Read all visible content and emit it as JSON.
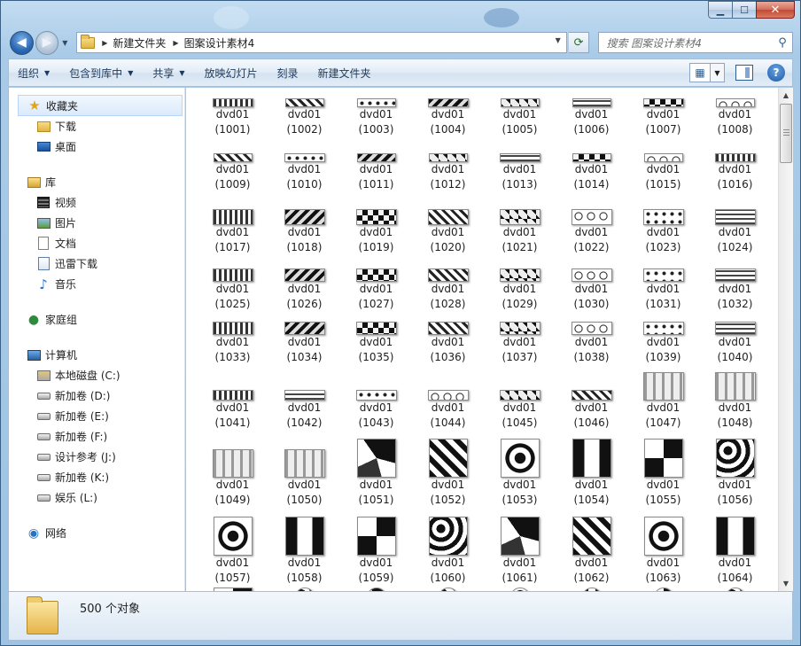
{
  "window": {
    "caption": {
      "minimize": "▁",
      "maximize": "☐",
      "close": "✕"
    }
  },
  "nav": {
    "back_icon": "◀",
    "forward_icon": "▶",
    "breadcrumb": [
      "新建文件夹",
      "图案设计素材4"
    ],
    "refresh_icon": "⟳",
    "search_placeholder": "搜索 图案设计素材4",
    "search_icon": "⚲"
  },
  "toolbar": {
    "organize": "组织",
    "include_in_library": "包含到库中",
    "share": "共享",
    "slideshow": "放映幻灯片",
    "burn": "刻录",
    "new_folder": "新建文件夹",
    "help": "?"
  },
  "sidebar": {
    "favorites": {
      "label": "收藏夹",
      "items": [
        "下载",
        "桌面"
      ]
    },
    "libraries": {
      "label": "库",
      "items": [
        "视频",
        "图片",
        "文档",
        "迅雷下载",
        "音乐"
      ]
    },
    "homegroup": {
      "label": "家庭组"
    },
    "computer": {
      "label": "计算机",
      "items": [
        "本地磁盘 (C:)",
        "新加卷 (D:)",
        "新加卷 (E:)",
        "新加卷 (F:)",
        "设计参考 (J:)",
        "新加卷 (K:)",
        "娱乐 (L:)"
      ]
    },
    "network": {
      "label": "网络"
    }
  },
  "files": [
    {
      "name": "dvd01",
      "num": "(1001)"
    },
    {
      "name": "dvd01",
      "num": "(1002)"
    },
    {
      "name": "dvd01",
      "num": "(1003)"
    },
    {
      "name": "dvd01",
      "num": "(1004)"
    },
    {
      "name": "dvd01",
      "num": "(1005)"
    },
    {
      "name": "dvd01",
      "num": "(1006)"
    },
    {
      "name": "dvd01",
      "num": "(1007)"
    },
    {
      "name": "dvd01",
      "num": "(1008)"
    },
    {
      "name": "dvd01",
      "num": "(1009)"
    },
    {
      "name": "dvd01",
      "num": "(1010)"
    },
    {
      "name": "dvd01",
      "num": "(1011)"
    },
    {
      "name": "dvd01",
      "num": "(1012)"
    },
    {
      "name": "dvd01",
      "num": "(1013)"
    },
    {
      "name": "dvd01",
      "num": "(1014)"
    },
    {
      "name": "dvd01",
      "num": "(1015)"
    },
    {
      "name": "dvd01",
      "num": "(1016)"
    },
    {
      "name": "dvd01",
      "num": "(1017)"
    },
    {
      "name": "dvd01",
      "num": "(1018)"
    },
    {
      "name": "dvd01",
      "num": "(1019)"
    },
    {
      "name": "dvd01",
      "num": "(1020)"
    },
    {
      "name": "dvd01",
      "num": "(1021)"
    },
    {
      "name": "dvd01",
      "num": "(1022)"
    },
    {
      "name": "dvd01",
      "num": "(1023)"
    },
    {
      "name": "dvd01",
      "num": "(1024)"
    },
    {
      "name": "dvd01",
      "num": "(1025)"
    },
    {
      "name": "dvd01",
      "num": "(1026)"
    },
    {
      "name": "dvd01",
      "num": "(1027)"
    },
    {
      "name": "dvd01",
      "num": "(1028)"
    },
    {
      "name": "dvd01",
      "num": "(1029)"
    },
    {
      "name": "dvd01",
      "num": "(1030)"
    },
    {
      "name": "dvd01",
      "num": "(1031)"
    },
    {
      "name": "dvd01",
      "num": "(1032)"
    },
    {
      "name": "dvd01",
      "num": "(1033)"
    },
    {
      "name": "dvd01",
      "num": "(1034)"
    },
    {
      "name": "dvd01",
      "num": "(1035)"
    },
    {
      "name": "dvd01",
      "num": "(1036)"
    },
    {
      "name": "dvd01",
      "num": "(1037)"
    },
    {
      "name": "dvd01",
      "num": "(1038)"
    },
    {
      "name": "dvd01",
      "num": "(1039)"
    },
    {
      "name": "dvd01",
      "num": "(1040)"
    },
    {
      "name": "dvd01",
      "num": "(1041)"
    },
    {
      "name": "dvd01",
      "num": "(1042)"
    },
    {
      "name": "dvd01",
      "num": "(1043)"
    },
    {
      "name": "dvd01",
      "num": "(1044)"
    },
    {
      "name": "dvd01",
      "num": "(1045)"
    },
    {
      "name": "dvd01",
      "num": "(1046)"
    },
    {
      "name": "dvd01",
      "num": "(1047)"
    },
    {
      "name": "dvd01",
      "num": "(1048)"
    },
    {
      "name": "dvd01",
      "num": "(1049)"
    },
    {
      "name": "dvd01",
      "num": "(1050)"
    },
    {
      "name": "dvd01",
      "num": "(1051)"
    },
    {
      "name": "dvd01",
      "num": "(1052)"
    },
    {
      "name": "dvd01",
      "num": "(1053)"
    },
    {
      "name": "dvd01",
      "num": "(1054)"
    },
    {
      "name": "dvd01",
      "num": "(1055)"
    },
    {
      "name": "dvd01",
      "num": "(1056)"
    },
    {
      "name": "dvd01",
      "num": "(1057)"
    },
    {
      "name": "dvd01",
      "num": "(1058)"
    },
    {
      "name": "dvd01",
      "num": "(1059)"
    },
    {
      "name": "dvd01",
      "num": "(1060)"
    },
    {
      "name": "dvd01",
      "num": "(1061)"
    },
    {
      "name": "dvd01",
      "num": "(1062)"
    },
    {
      "name": "dvd01",
      "num": "(1063)"
    },
    {
      "name": "dvd01",
      "num": "(1064)"
    }
  ],
  "status": {
    "count": "500 个对象"
  },
  "scrollbar": {
    "up": "▲",
    "down": "▼"
  }
}
